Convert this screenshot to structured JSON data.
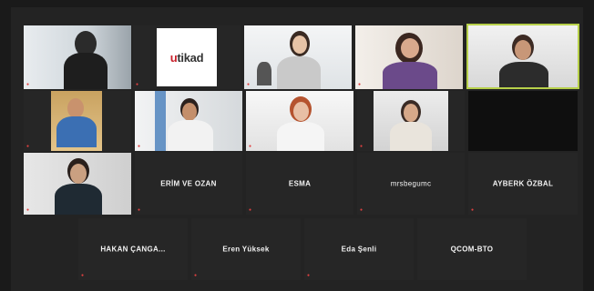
{
  "meeting": {
    "row1": [
      {
        "id": "t1",
        "label": "",
        "muted": true
      },
      {
        "id": "t2",
        "label": "",
        "logo": "utikad",
        "muted": true
      },
      {
        "id": "t3",
        "label": "",
        "muted": true
      },
      {
        "id": "t4",
        "label": "",
        "muted": true
      },
      {
        "id": "t5",
        "label": "",
        "muted": false,
        "speaking": true
      }
    ],
    "row2": [
      {
        "id": "t6",
        "label": "",
        "muted": true
      },
      {
        "id": "t7",
        "label": "",
        "muted": true
      },
      {
        "id": "t8",
        "label": "",
        "muted": true
      },
      {
        "id": "t9",
        "label": "",
        "muted": true
      },
      {
        "id": "t10",
        "label": "",
        "muted": false
      }
    ],
    "row3": [
      {
        "id": "t11",
        "label": "",
        "muted": true
      },
      {
        "id": "t12",
        "display_name": "ERİM VE OZAN",
        "label": "",
        "muted": true
      },
      {
        "id": "t13",
        "display_name": "ESMA",
        "label": "",
        "muted": true
      },
      {
        "id": "t14",
        "display_name": "mrsbegumc",
        "label": "",
        "muted": true
      },
      {
        "id": "t15",
        "display_name": "AYBERK ÖZBAL",
        "label": "",
        "muted": true
      }
    ],
    "row4": [
      {
        "id": "t16",
        "display_name": "HAKAN ÇANGA...",
        "label": "",
        "muted": true
      },
      {
        "id": "t17",
        "display_name": "Eren Yüksek",
        "label": "",
        "muted": true
      },
      {
        "id": "t18",
        "display_name": "Eda Şenli",
        "label": "",
        "muted": true
      },
      {
        "id": "t19",
        "display_name": "QCOM-BTO",
        "label": "",
        "muted": false
      }
    ]
  },
  "logo": {
    "prefix": "u",
    "text": "utikad"
  },
  "colors": {
    "speaking_border": "#b7d04a",
    "muted_icon": "#e04040",
    "tile_bg": "#262626"
  }
}
